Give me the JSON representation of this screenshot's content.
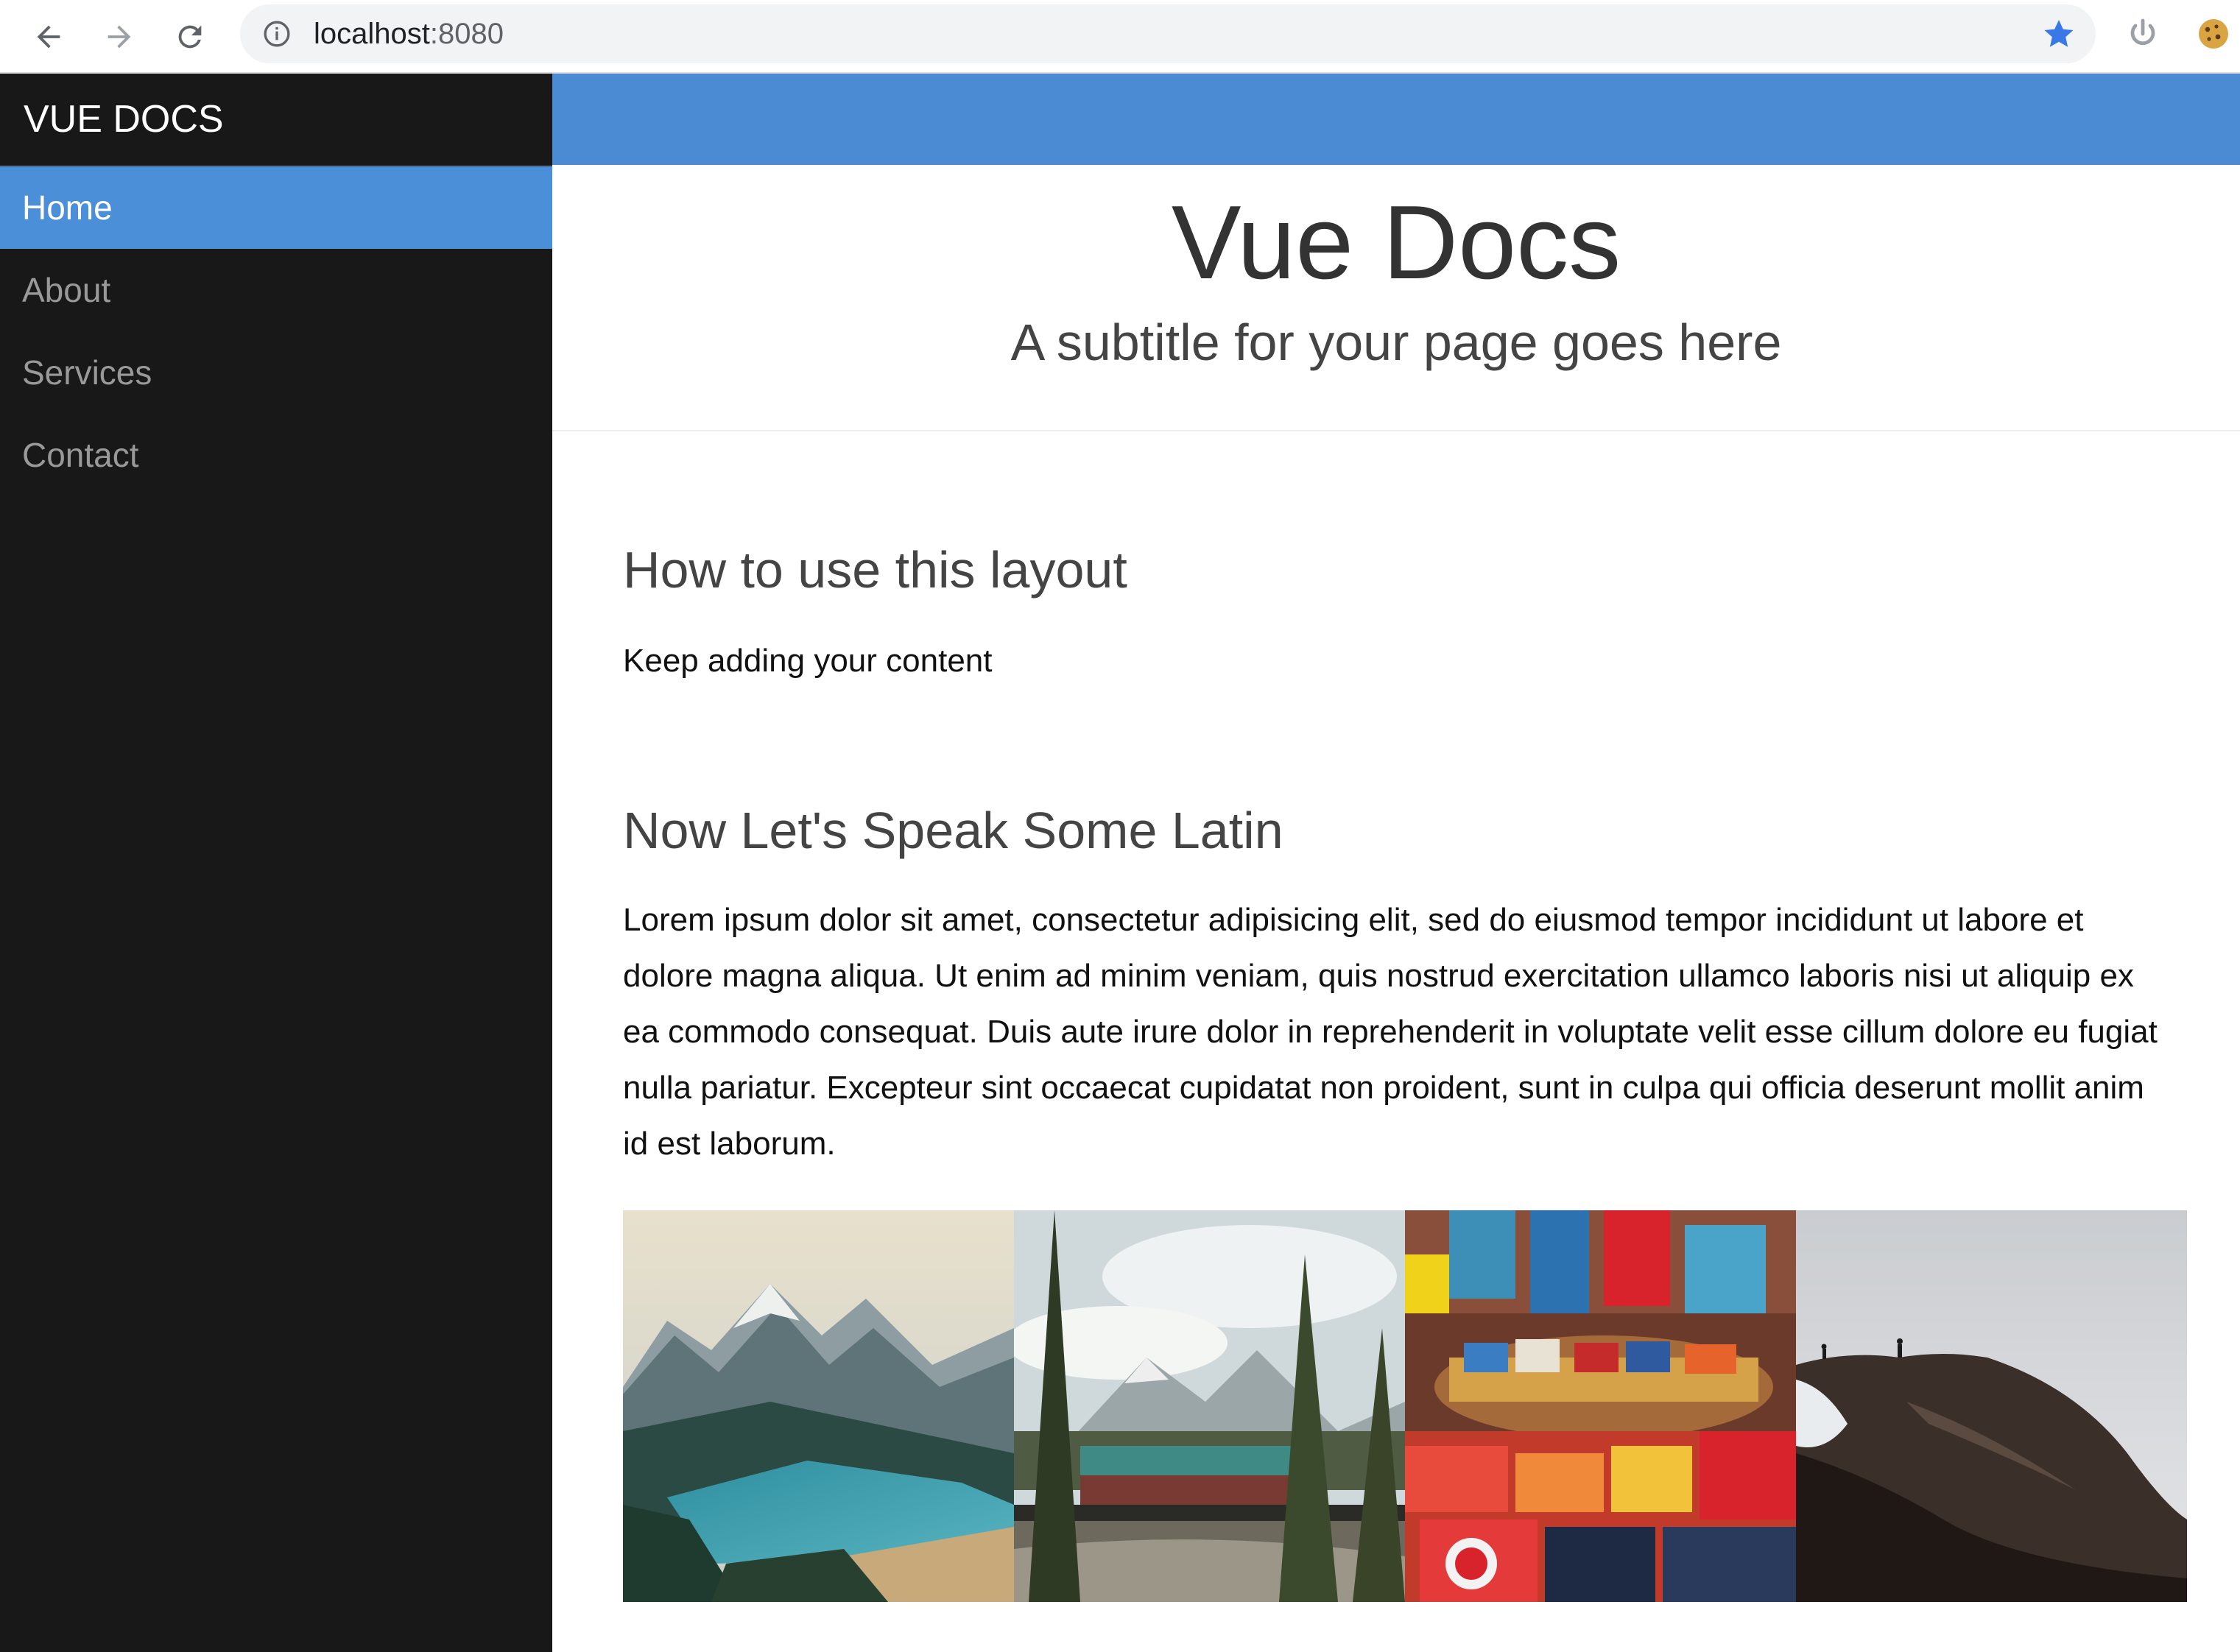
{
  "browser": {
    "url_host": "localhost",
    "url_port": ":8080",
    "icons": [
      "back-icon",
      "forward-icon",
      "reload-icon",
      "info-icon",
      "star-icon",
      "power-icon",
      "cookie-icon"
    ]
  },
  "sidebar": {
    "brand": "VUE DOCS",
    "items": [
      {
        "label": "Home",
        "active": true
      },
      {
        "label": "About",
        "active": false
      },
      {
        "label": "Services",
        "active": false
      },
      {
        "label": "Contact",
        "active": false
      }
    ]
  },
  "header": {
    "title": "Vue Docs",
    "subtitle": "A subtitle for your page goes here"
  },
  "content": {
    "section1_heading": "How to use this layout",
    "section1_text": "Keep adding your content",
    "section2_heading": "Now Let's Speak Some Latin",
    "section2_text": "Lorem ipsum dolor sit amet, consectetur adipisicing elit, sed do eiusmod tempor incididunt ut labore et dolore magna aliqua. Ut enim ad minim veniam, quis nostrud exercitation ullamco laboris nisi ut aliquip ex ea commodo consequat. Duis aute irure dolor in reprehenderit in voluptate velit esse cillum dolore eu fugiat nulla pariatur. Excepteur sint occaecat cupidatat non proident, sunt in culpa qui officia deserunt mollit anim id est laborum."
  },
  "gallery": [
    "mountain-lake-photo",
    "forest-train-photo",
    "clothing-store-photo",
    "hikers-cliff-photo"
  ],
  "colors": {
    "sidebar_bg": "#191818",
    "accent": "#4a8fd7",
    "topbar": "#4a8bd3",
    "menu_text": "#999999"
  }
}
